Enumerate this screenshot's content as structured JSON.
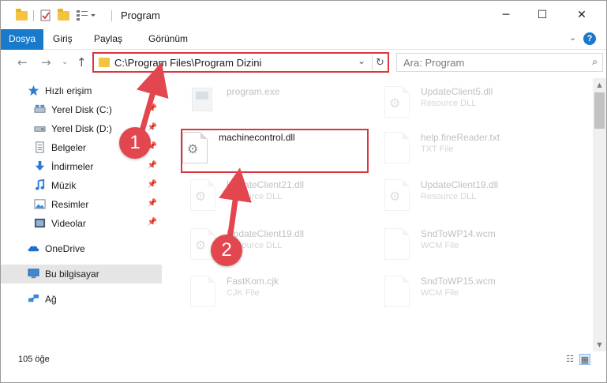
{
  "window": {
    "title": "Program",
    "minimize_glyph": "─",
    "maximize_glyph": "☐",
    "close_glyph": "✕"
  },
  "ribbon": {
    "tabs": [
      "Dosya",
      "Giriş",
      "Paylaş",
      "Görünüm"
    ],
    "help_glyph": "?",
    "expand_glyph": "⌄"
  },
  "address": {
    "path": "C:\\Program Files\\Program Dizini",
    "search_placeholder": "Ara: Program"
  },
  "sidebar": {
    "items": [
      {
        "label": "Hızlı erişim",
        "icon": "star-icon",
        "pinned": false
      },
      {
        "label": "Yerel Disk (C:)",
        "icon": "drive-icon",
        "pinned": true
      },
      {
        "label": "Yerel Disk (D:)",
        "icon": "drive-icon",
        "pinned": true
      },
      {
        "label": "Belgeler",
        "icon": "documents-icon",
        "pinned": true
      },
      {
        "label": "İndirmeler",
        "icon": "download-icon",
        "pinned": true
      },
      {
        "label": "Müzik",
        "icon": "music-icon",
        "pinned": true
      },
      {
        "label": "Resimler",
        "icon": "pictures-icon",
        "pinned": true
      },
      {
        "label": "Videolar",
        "icon": "videos-icon",
        "pinned": true
      },
      {
        "label": "OneDrive",
        "icon": "cloud-icon",
        "pinned": false
      },
      {
        "label": "Bu bilgisayar",
        "icon": "computer-icon",
        "pinned": false
      },
      {
        "label": "Ağ",
        "icon": "network-icon",
        "pinned": false
      }
    ],
    "pin_glyph": "📌"
  },
  "files": [
    {
      "name": "program.exe",
      "type": ""
    },
    {
      "name": "UpdateClient5.dll",
      "type": "Resource DLL"
    },
    {
      "name": "machinecontrol.dll",
      "type": ""
    },
    {
      "name": "help.fineReader.txt",
      "type": "TXT File"
    },
    {
      "name": "UpdateClient21.dll",
      "type": "Resource DLL"
    },
    {
      "name": "UpdateClient19.dll",
      "type": "Resource DLL"
    },
    {
      "name": "UpdateClient19.dll",
      "type": "Resource DLL"
    },
    {
      "name": "SndToWP14.wcm",
      "type": "WCM File"
    },
    {
      "name": "FastKom.cjk",
      "type": "CJK File"
    },
    {
      "name": "SndToWP15.wcm",
      "type": "WCM File"
    }
  ],
  "status": {
    "item_count": "105 öğe"
  },
  "annotations": {
    "step1": "1",
    "step2": "2",
    "color": "#e2464e"
  }
}
